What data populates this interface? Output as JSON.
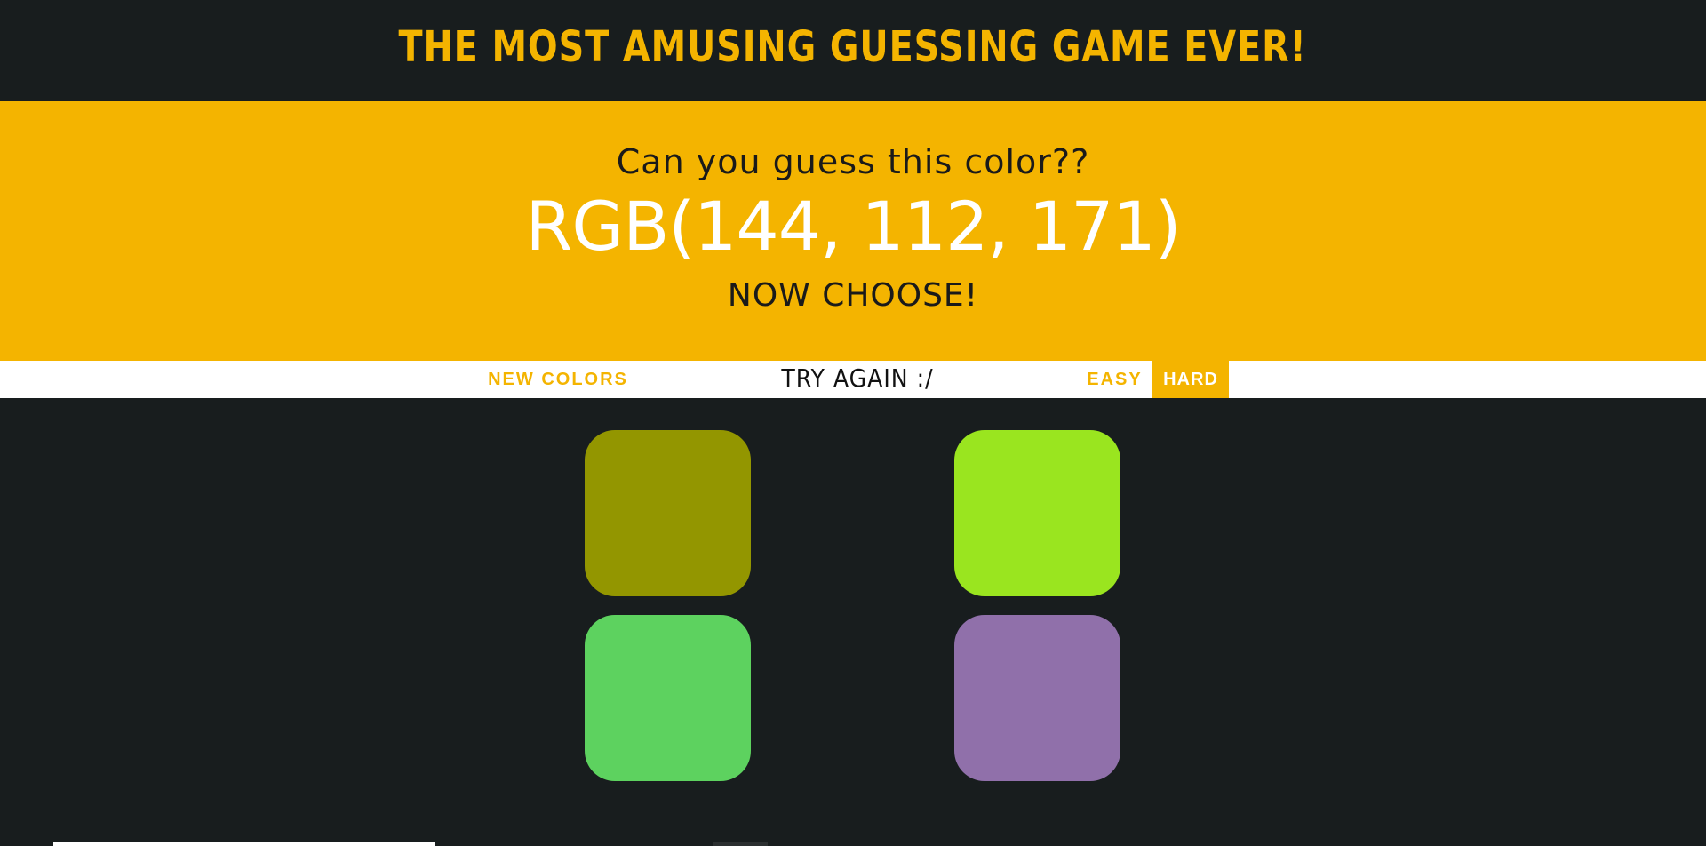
{
  "header": {
    "title": "THE MOST AMUSING GUESSING GAME EVER!",
    "title_color": "#f4b400",
    "background": "#181d1e"
  },
  "banner": {
    "question": "Can you guess this color??",
    "rgb_target": "RGB(144, 112, 171)",
    "prompt": "NOW CHOOSE!",
    "background": "#f4b400"
  },
  "controls": {
    "new_colors_label": "NEW COLORS",
    "status_message": "TRY AGAIN :/",
    "easy_label": "EASY",
    "hard_label": "HARD",
    "selected_mode": "HARD"
  },
  "tiles": [
    {
      "color": "#939600"
    },
    {
      "color": "#9ae51f"
    },
    {
      "color": "#5dd25f"
    },
    {
      "color": "#9070aa"
    }
  ]
}
